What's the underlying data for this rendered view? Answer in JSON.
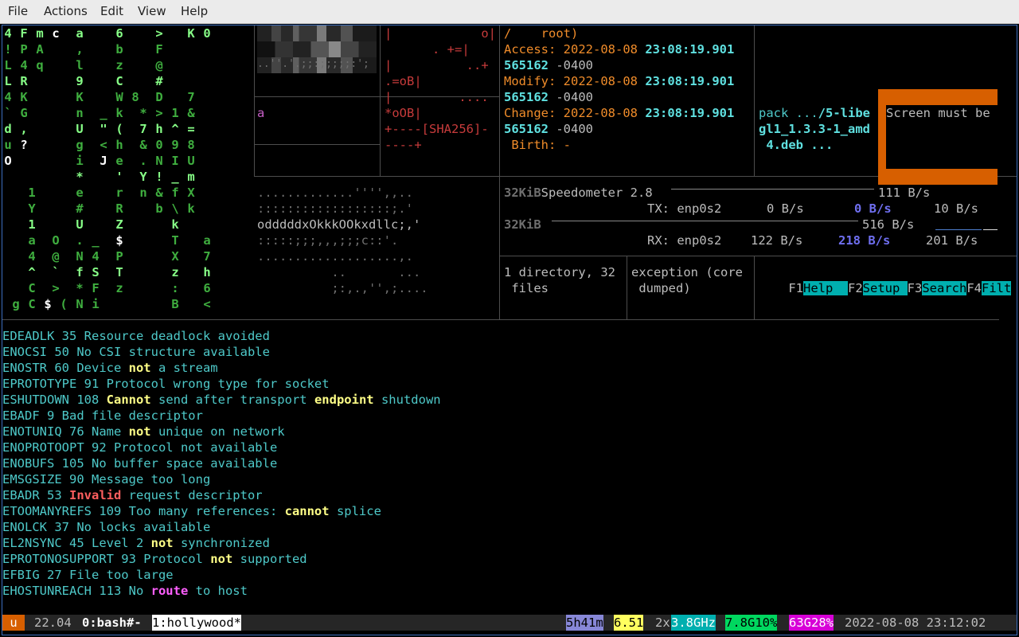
{
  "menu": {
    "file": "File",
    "actions": "Actions",
    "edit": "Edit",
    "view": "View",
    "help": "Help"
  },
  "matrix": {
    "rows_green": [
      "4 F m c  a    6    >   K 0",
      "! P A    ,    b    F",
      "L 4 q    l    z    @",
      "L R      9    C    #",
      "4 K      K    W 8  D   7",
      "` G      n  _ k  * > 1 &",
      "d ,      U  \" (  7 h ^ =",
      "u ?      g  < h  & 0 9 8",
      "O        i  J e  . N I U",
      "         *    '  Y ! _ m",
      "   1     e    r  n & f X",
      "   Y     #    R    b \\ k",
      "   1     U    Z      k",
      "   a  O  . _  $      T   a",
      "   4  @  N 4  P      X   7",
      "   ^  `  f S  T      z   h",
      "   C  >  * F  z      :   6",
      " g C $ ( N i         B   <"
    ]
  },
  "hexdump": {
    "lines": [
      "",
      "",
      ""
    ]
  },
  "randomart": {
    "lines": [
      "|            o|",
      ". +=|",
      "|          ..+",
      ".=oB|",
      "|         ....",
      "*oOB|",
      "+----[SHA256]-",
      "----+"
    ]
  },
  "pane_a": {
    "text": "a"
  },
  "ascii_art": {
    "lines": [
      ".............'''',,..",
      "::::::::::::::::::;.'",
      "odddddxOkkkOOkxdllc;,'",
      ":::::;;;,,,;;;c::'.",
      "...................,.",
      "          ..       ...",
      "          ;:,.,'',;...."
    ]
  },
  "stat": {
    "path_line": "/    root)",
    "access_label": "Access:",
    "access_date": "2022-08-08",
    "access_time": "23:08:19.901",
    "access_frac": "565162",
    "access_tz": "-0400",
    "modify_label": "Modify:",
    "modify_date": "2022-08-08",
    "modify_time": "23:08:19.901",
    "modify_frac": "565162",
    "modify_tz": "-0400",
    "change_label": "Change:",
    "change_date": "2022-08-08",
    "change_time": "23:08:19.901",
    "change_frac": "565162",
    "change_tz": "-0400",
    "birth_label": " Birth:",
    "birth_value": "-"
  },
  "apt": {
    "line1_a": "pack ...",
    "line1_b": "/5-libe",
    "line2": "gl1_1.3.3-1_amd",
    "line3": " 4.deb ..."
  },
  "cmatrix_warning": {
    "text": "Screen must be"
  },
  "speedometer": {
    "row1_label": "32KiB",
    "row1_title": "Speedometer 2.8",
    "row1_rate": "111 B/s",
    "tx_label": "TX: enp0s2",
    "tx_cur": "0 B/s",
    "tx_avg": "0 B/s",
    "tx_max": "10 B/s",
    "row2_label": "32KiB",
    "row2_rate": "516 B/s",
    "rx_label": "RX: enp0s2",
    "rx_cur": "122 B/s",
    "rx_avg": "218 B/s",
    "rx_max": "201 B/s"
  },
  "tree_summary": {
    "line1": "1 directory, 32",
    "line2": " files"
  },
  "exception": {
    "line1": "exception (core",
    "line2": " dumped)"
  },
  "htop_keys": [
    {
      "key": "F1",
      "label": "Help  "
    },
    {
      "key": "F2",
      "label": "Setup "
    },
    {
      "key": "F3",
      "label": "Search"
    },
    {
      "key": "F4",
      "label": "Filt"
    }
  ],
  "errno_lines": [
    [
      {
        "t": "EDEADLK 35 Resource deadlock avoided",
        "c": "cyan"
      }
    ],
    [
      {
        "t": "ENOCSI 50 No CSI structure available",
        "c": "cyan"
      }
    ],
    [
      {
        "t": "ENOSTR 60 Device ",
        "c": "cyan"
      },
      {
        "t": "not",
        "c": "yellowb"
      },
      {
        "t": " a stream",
        "c": "cyan"
      }
    ],
    [
      {
        "t": "EPROTOTYPE 91 Protocol wrong type for socket",
        "c": "cyan"
      }
    ],
    [
      {
        "t": "ESHUTDOWN 108 ",
        "c": "cyan"
      },
      {
        "t": "Cannot",
        "c": "yellowb"
      },
      {
        "t": " send after transport ",
        "c": "cyan"
      },
      {
        "t": "endpoint",
        "c": "yellowb"
      },
      {
        "t": " shutdown",
        "c": "cyan"
      }
    ],
    [
      {
        "t": "EBADF 9 Bad file descriptor",
        "c": "cyan"
      }
    ],
    [
      {
        "t": "ENOTUNIQ 76 Name ",
        "c": "cyan"
      },
      {
        "t": "not",
        "c": "yellowb"
      },
      {
        "t": " unique on network",
        "c": "cyan"
      }
    ],
    [
      {
        "t": "ENOPROTOOPT 92 Protocol not available",
        "c": "cyan"
      }
    ],
    [
      {
        "t": "ENOBUFS 105 No buffer space available",
        "c": "cyan"
      }
    ],
    [
      {
        "t": "EMSGSIZE 90 Message too long",
        "c": "cyan"
      }
    ],
    [
      {
        "t": "EBADR 53 ",
        "c": "cyan"
      },
      {
        "t": "Invalid",
        "c": "redb"
      },
      {
        "t": " request descriptor",
        "c": "cyan"
      }
    ],
    [
      {
        "t": "ETOOMANYREFS 109 Too many references: ",
        "c": "cyan"
      },
      {
        "t": "cannot",
        "c": "yellowb"
      },
      {
        "t": " splice",
        "c": "cyan"
      }
    ],
    [
      {
        "t": "ENOLCK 37 No locks available",
        "c": "cyan"
      }
    ],
    [
      {
        "t": "EL2NSYNC 45 Level 2 ",
        "c": "cyan"
      },
      {
        "t": "not",
        "c": "yellowb"
      },
      {
        "t": " synchronized",
        "c": "cyan"
      }
    ],
    [
      {
        "t": "EPROTONOSUPPORT 93 Protocol ",
        "c": "cyan"
      },
      {
        "t": "not",
        "c": "yellowb"
      },
      {
        "t": " supported",
        "c": "cyan"
      }
    ],
    [
      {
        "t": "EFBIG 27 File too large",
        "c": "cyan"
      }
    ],
    [
      {
        "t": "EHOSTUNREACH 113 No ",
        "c": "cyan"
      },
      {
        "t": "route",
        "c": "pinkb"
      },
      {
        "t": " to host",
        "c": "cyan"
      }
    ]
  ],
  "statusbar": {
    "session_icon": "u",
    "version": "22.04",
    "window0": "0:bash#-",
    "window1": "1:hollywood*",
    "uptime": "5h41m",
    "load": "6.51",
    "cpu_count": "2x",
    "cpu_freq": "3.8GHz",
    "mem": "7.8G10%",
    "disk": "63G28%",
    "datetime": "2022-08-08 23:12:02",
    "colors": {
      "bar": "#262626",
      "session": "#d75f00",
      "uptime": "#8787d7",
      "load": "#ffff5f",
      "cpu": "#00afaf",
      "mem": "#00d75f",
      "disk": "#d700d7"
    }
  }
}
